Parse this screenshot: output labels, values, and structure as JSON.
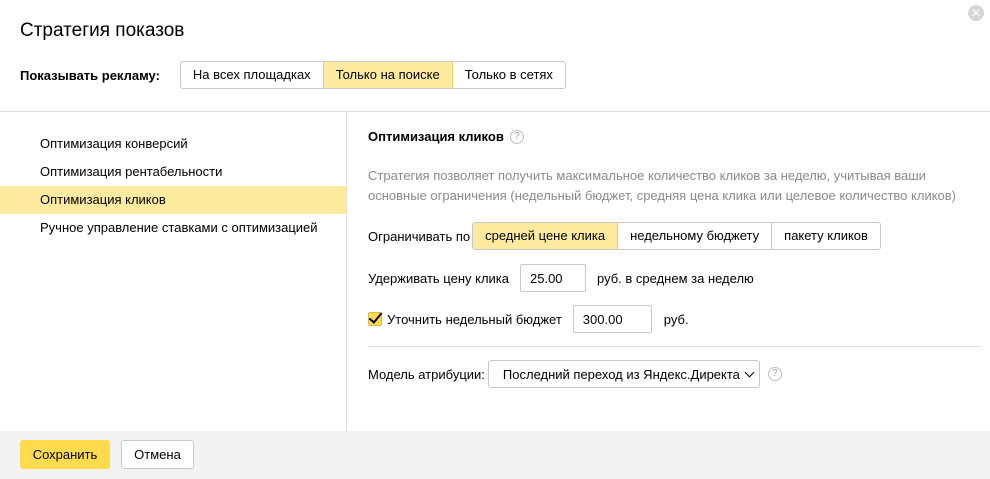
{
  "dialog": {
    "title": "Стратегия показов",
    "close_icon": "close-icon"
  },
  "show_ads": {
    "label": "Показывать рекламу:",
    "options": [
      "На всех площадках",
      "Только на поиске",
      "Только в сетях"
    ],
    "selected": "Только на поиске"
  },
  "sidebar": {
    "items": [
      {
        "label": "Оптимизация конверсий"
      },
      {
        "label": "Оптимизация рентабельности"
      },
      {
        "label": "Оптимизация кликов"
      },
      {
        "label": "Ручное управление ставками с оптимизацией"
      }
    ],
    "selected": "Оптимизация кликов"
  },
  "main": {
    "section_title": "Оптимизация кликов",
    "help_icon": "question-circle-icon",
    "description": "Стратегия позволяет получить максимальное количество кликов за неделю, учитывая ваши основные ограничения (недельный бюджет, средняя цена клика или целевое количество кликов)",
    "limit": {
      "label": "Ограничивать по",
      "options": [
        "средней цене клика",
        "недельному бюджету",
        "пакету кликов"
      ],
      "selected": "средней цене клика"
    },
    "hold_price": {
      "label": "Удерживать цену клика",
      "value": "25.00",
      "unit": "руб. в среднем за неделю"
    },
    "weekly_budget": {
      "checked": true,
      "label": "Уточнить недельный бюджет",
      "value": "300.00",
      "unit": "руб."
    },
    "attribution": {
      "label": "Модель атрибуции:",
      "selected": "Последний переход из Яндекс.Директа"
    }
  },
  "footer": {
    "save_label": "Сохранить",
    "cancel_label": "Отмена"
  },
  "colors": {
    "accent_yellow": "#ffdb4d",
    "active_bg": "#ffeba0",
    "footer_bg": "#f2f2f2",
    "muted_text": "#8a8a8a"
  }
}
